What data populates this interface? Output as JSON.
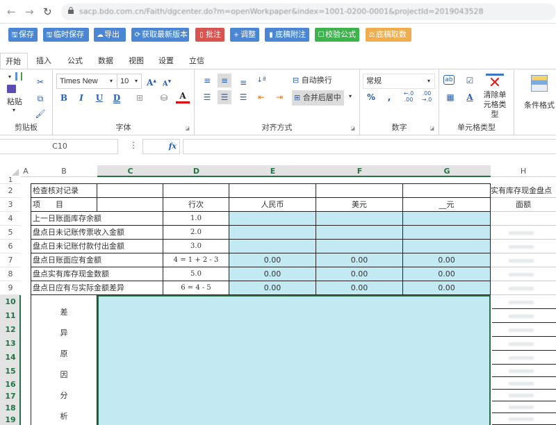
{
  "browser": {
    "url": "sacp.bdo.com.cn/Faith/dgcenter.do?m=openWorkpaper&index=1001-0200-0001&projectId=2019043528"
  },
  "actions": [
    {
      "label": "保存",
      "icon": "save-icon",
      "color": "#4a86d4"
    },
    {
      "label": "临时保存",
      "icon": "save-icon",
      "color": "#4a86d4"
    },
    {
      "label": "导出",
      "icon": "cloud-upload-icon",
      "color": "#4a86d4"
    },
    {
      "label": "获取最新版本",
      "icon": "refresh-icon",
      "color": "#4a86d4"
    },
    {
      "label": "批注",
      "icon": "comment-icon",
      "color": "#d9534f"
    },
    {
      "label": "调整",
      "icon": "plus-icon",
      "color": "#4a86d4"
    },
    {
      "label": "底稿附注",
      "icon": "file-icon",
      "color": "#4a86d4"
    },
    {
      "label": "校验公式",
      "icon": "checkbox-icon",
      "color": "#3cb44b"
    },
    {
      "label": "底稿取数",
      "icon": "balance-icon",
      "color": "#f0ad4e"
    }
  ],
  "ribbon_tabs": [
    "开始",
    "插入",
    "公式",
    "数据",
    "视图",
    "设置",
    "立信"
  ],
  "ribbon": {
    "clipboard": {
      "label": "剪贴板",
      "paste": "粘贴"
    },
    "font": {
      "label": "字体",
      "font_name": "Times New",
      "font_size": "10"
    },
    "align": {
      "label": "对齐方式",
      "wrap": "自动换行",
      "merge": "合并后居中"
    },
    "number": {
      "label": "数字",
      "format": "常规"
    },
    "cell_type": {
      "label": "单元格类型",
      "clear": "清除单元格类型"
    },
    "cond_format": {
      "label": "条件格式"
    }
  },
  "formula_bar": {
    "name_box": "C10",
    "fx": "fx",
    "formula": ""
  },
  "sheet": {
    "columns": [
      "A",
      "B",
      "C",
      "D",
      "E",
      "F",
      "G",
      "H"
    ],
    "selected_columns": [
      "C",
      "D",
      "E",
      "F",
      "G"
    ],
    "rows": [
      "1",
      "2",
      "3",
      "4",
      "5",
      "6",
      "7",
      "8",
      "9",
      "10",
      "11",
      "12",
      "13",
      "14",
      "15",
      "16",
      "17",
      "18",
      "19"
    ],
    "selected_rows_from": 10,
    "title": "检查核对记录",
    "header": {
      "item": "项　　目",
      "line": "行次",
      "rmb": "人民币",
      "usd": "美元",
      "other": "__元",
      "h_title": "实有库存现金盘点",
      "h_face": "面额"
    },
    "lines": [
      {
        "item": "上一日账面库存余额",
        "line": "1.0",
        "rmb": "",
        "usd": "",
        "other": ""
      },
      {
        "item": "盘点日未记账传票收入金额",
        "line": "2.0",
        "rmb": "",
        "usd": "",
        "other": ""
      },
      {
        "item": "盘点日未记账付款付出金额",
        "line": "3.0",
        "rmb": "",
        "usd": "",
        "other": ""
      },
      {
        "item": "盘点日账面应有金额",
        "line": "4 = 1 + 2 - 3",
        "rmb": "0.00",
        "usd": "0.00",
        "other": "0.00"
      },
      {
        "item": "盘点实有库存现金数额",
        "line": "5.0",
        "rmb": "0.00",
        "usd": "0.00",
        "other": "0.00"
      },
      {
        "item": "盘点日应有与实际金额差异",
        "line": "6 = 4 - 5",
        "rmb": "0.00",
        "usd": "0.00",
        "other": "0.00"
      }
    ],
    "analysis_label": [
      "差",
      "异",
      "原",
      "因",
      "分",
      "析"
    ]
  }
}
